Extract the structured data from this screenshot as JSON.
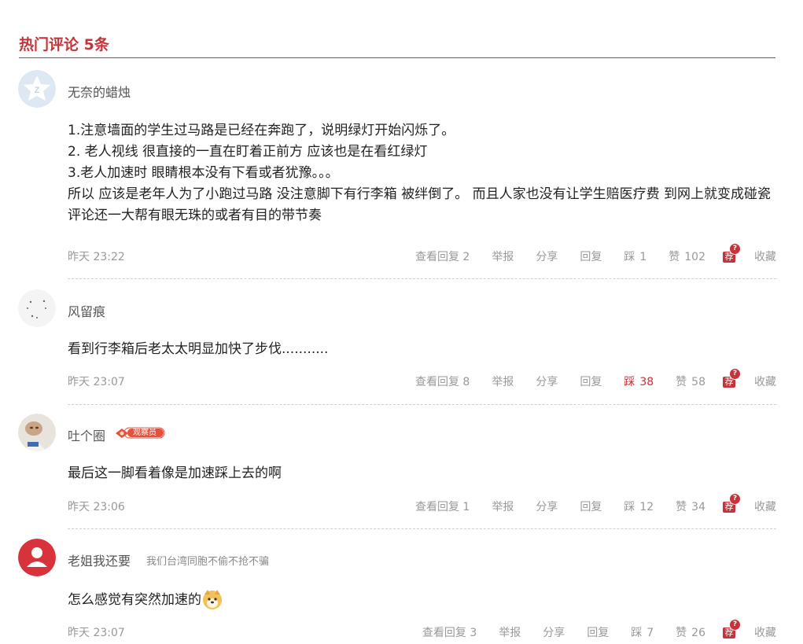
{
  "header": {
    "title": "热门评论 5条"
  },
  "icons": {
    "recommend_char": "荐",
    "recommend_q": "?"
  },
  "colors": {
    "accent": "#c4343a",
    "meta_gray": "#999999"
  },
  "comments": [
    {
      "user": "无奈的蜡烛",
      "lines": [
        "1.注意墙面的学生过马路是已经在奔跑了，说明绿灯开始闪烁了。",
        "2. 老人视线 很直接的一直在盯着正前方  应该也是在看红绿灯",
        "3.老人加速时 眼睛根本没有下看或者犹豫。。。",
        "所以  应该是老年人为了小跑过马路 没注意脚下有行李箱 被绊倒了。   而且人家也没有让学生赔医疗费 到网上就变成碰瓷   评论还一大帮有眼无珠的或者有目的带节奏"
      ],
      "time": "昨天 23:22",
      "view_replies": "查看回复 2",
      "report": "举报",
      "share": "分享",
      "reply": "回复",
      "dislike_label": "踩",
      "dislike_count": "1",
      "like_label": "赞",
      "like_count": "102",
      "collect": "收藏"
    },
    {
      "user": "风留痕",
      "lines": [
        "看到行李箱后老太太明显加快了步伐..........."
      ],
      "time": "昨天 23:07",
      "view_replies": "查看回复 8",
      "report": "举报",
      "share": "分享",
      "reply": "回复",
      "dislike_label": "踩",
      "dislike_count": "38",
      "like_label": "赞",
      "like_count": "58",
      "collect": "收藏"
    },
    {
      "user": "吐个圈",
      "badge": "观察员",
      "lines": [
        "最后这一脚看着像是加速踩上去的啊"
      ],
      "time": "昨天 23:06",
      "view_replies": "查看回复 1",
      "report": "举报",
      "share": "分享",
      "reply": "回复",
      "dislike_label": "踩",
      "dislike_count": "12",
      "like_label": "赞",
      "like_count": "34",
      "collect": "收藏"
    },
    {
      "user": "老姐我还要",
      "signature": "我们台湾同胞不偷不抢不骗",
      "lines": [
        "怎么感觉有突然加速的"
      ],
      "time": "昨天 23:07",
      "view_replies": "查看回复 3",
      "report": "举报",
      "share": "分享",
      "reply": "回复",
      "dislike_label": "踩",
      "dislike_count": "7",
      "like_label": "赞",
      "like_count": "26",
      "collect": "收藏"
    }
  ]
}
